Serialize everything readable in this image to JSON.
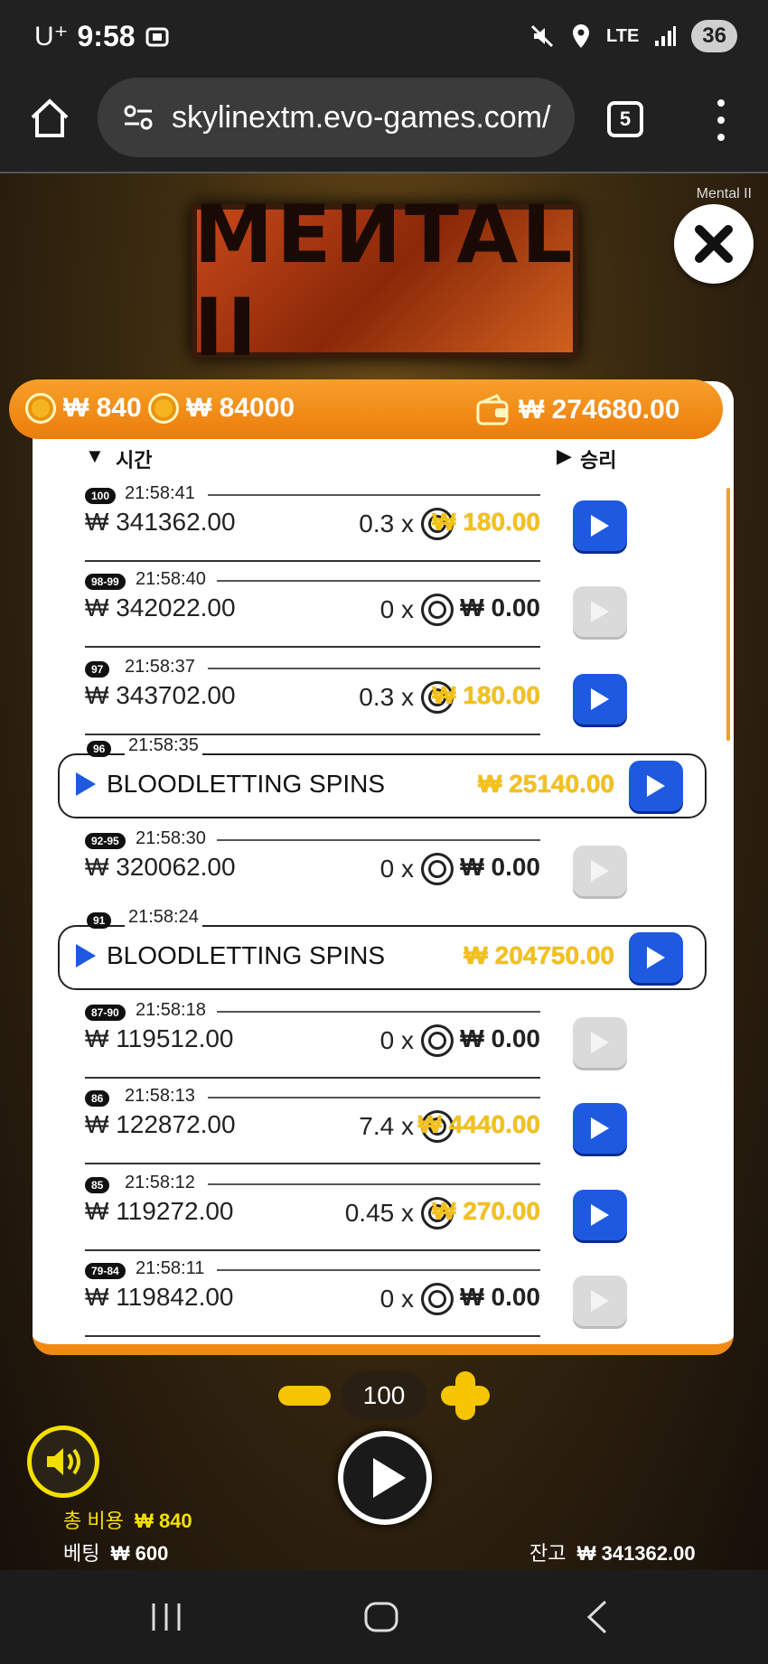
{
  "status_bar": {
    "carrier": "U⁺",
    "time": "9:58",
    "network": "LTE",
    "battery": "36"
  },
  "browser": {
    "url": "skylinextm.evo-games.com/",
    "tab_count": "5"
  },
  "game": {
    "name": "Mental II",
    "logo_text": "MEИTAL II",
    "top_bar": {
      "bet_coins": "₩ 840",
      "bet_total": "₩ 84000",
      "balance": "₩ 274680.00"
    },
    "history_header": {
      "time": "▼                                        ",
      "time_label": "시간",
      "win_label": "승리"
    },
    "history": [
      {
        "kind": "spin",
        "tag": "100",
        "time": "21:58:41",
        "balance": "₩ 341362.00",
        "multiplier": "0.3 x",
        "win": "₩ 180.00",
        "won": true
      },
      {
        "kind": "spin",
        "tag": "98-99",
        "time": "21:58:40",
        "balance": "₩ 342022.00",
        "multiplier": "0 x",
        "win": "₩ 0.00",
        "won": false
      },
      {
        "kind": "spin",
        "tag": "97",
        "time": "21:58:37",
        "balance": "₩ 343702.00",
        "multiplier": "0.3 x",
        "win": "₩ 180.00",
        "won": true
      },
      {
        "kind": "feature",
        "tag": "96",
        "time": "21:58:35",
        "label": "BLOODLETTING SPINS",
        "win": "₩ 25140.00"
      },
      {
        "kind": "spin",
        "tag": "92-95",
        "time": "21:58:30",
        "balance": "₩ 320062.00",
        "multiplier": "0 x",
        "win": "₩ 0.00",
        "won": false
      },
      {
        "kind": "feature",
        "tag": "91",
        "time": "21:58:24",
        "label": "BLOODLETTING SPINS",
        "win": "₩ 204750.00"
      },
      {
        "kind": "spin",
        "tag": "87-90",
        "time": "21:58:18",
        "balance": "₩ 119512.00",
        "multiplier": "0 x",
        "win": "₩ 0.00",
        "won": false
      },
      {
        "kind": "spin",
        "tag": "86",
        "time": "21:58:13",
        "balance": "₩ 122872.00",
        "multiplier": "7.4 x",
        "win": "₩ 4440.00",
        "won": true
      },
      {
        "kind": "spin",
        "tag": "85",
        "time": "21:58:12",
        "balance": "₩ 119272.00",
        "multiplier": "0.45 x",
        "win": "₩ 270.00",
        "won": true
      },
      {
        "kind": "spin",
        "tag": "79-84",
        "time": "21:58:11",
        "balance": "₩ 119842.00",
        "multiplier": "0 x",
        "win": "₩ 0.00",
        "won": false
      }
    ],
    "bet_level": "100",
    "bottom": {
      "total_cost_label": "총 비용",
      "total_cost": "₩ 840",
      "bet_label": "베팅",
      "bet": "₩ 600",
      "balance_label": "잔고",
      "balance": "₩ 341362.00"
    }
  },
  "colors": {
    "accent": "#f08a14",
    "play_button": "#1e5ae0",
    "win_gold": "#f3c21a"
  },
  "icons": [
    "home-icon",
    "tune-icon",
    "close-icon",
    "coin-icon",
    "wallet-icon",
    "play-icon",
    "sound-icon",
    "mute-icon",
    "location-icon",
    "signal-icon"
  ]
}
